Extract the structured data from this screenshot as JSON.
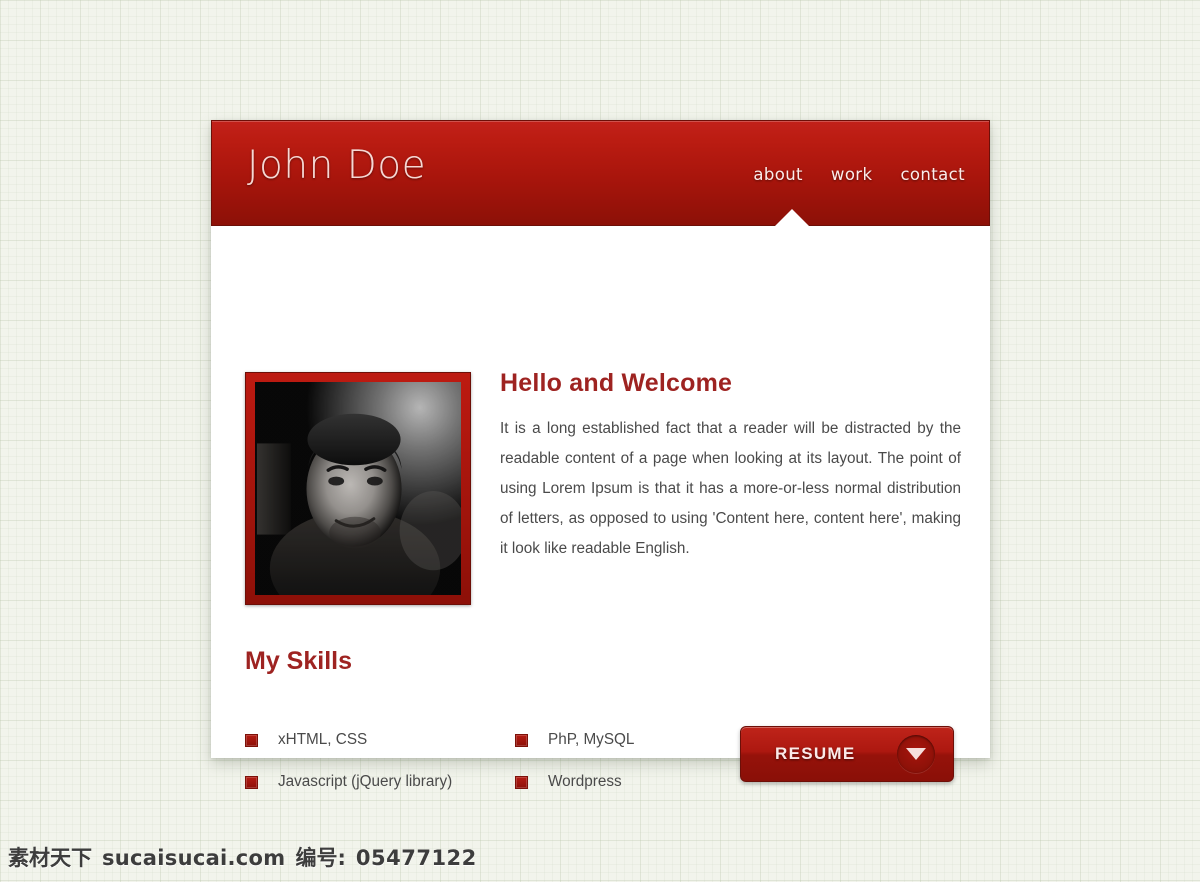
{
  "page": {
    "background_color": "#f2f4ec",
    "accent_color": "#9e2321",
    "header_red_top": "#c2211a",
    "header_red_bottom": "#8c1007"
  },
  "header": {
    "logo": "John Doe",
    "nav": [
      {
        "label": "about",
        "active": true
      },
      {
        "label": "work",
        "active": false
      },
      {
        "label": "contact",
        "active": false
      }
    ]
  },
  "main": {
    "photo_alt": "portrait-photo",
    "welcome_title": "Hello and Welcome",
    "welcome_text": "It is a long established fact that a reader will be distracted by the readable content of a page when looking at its layout. The point of using Lorem Ipsum is that it has a more-or-less normal distribution of letters, as opposed to using 'Content here, content here', making it look like readable English.",
    "skills_title": "My Skills",
    "skills_column_one": [
      "xHTML, CSS",
      "Javascript (jQuery library)"
    ],
    "skills_column_two": [
      "PhP, MySQL",
      "Wordpress"
    ],
    "resume_button": {
      "label": "RESUME",
      "icon": "chevron-down-icon"
    }
  },
  "watermark": {
    "site_cn": "素材天下",
    "site": "sucaisucai.com",
    "id_label": "编号:",
    "id_value": "05477122"
  }
}
